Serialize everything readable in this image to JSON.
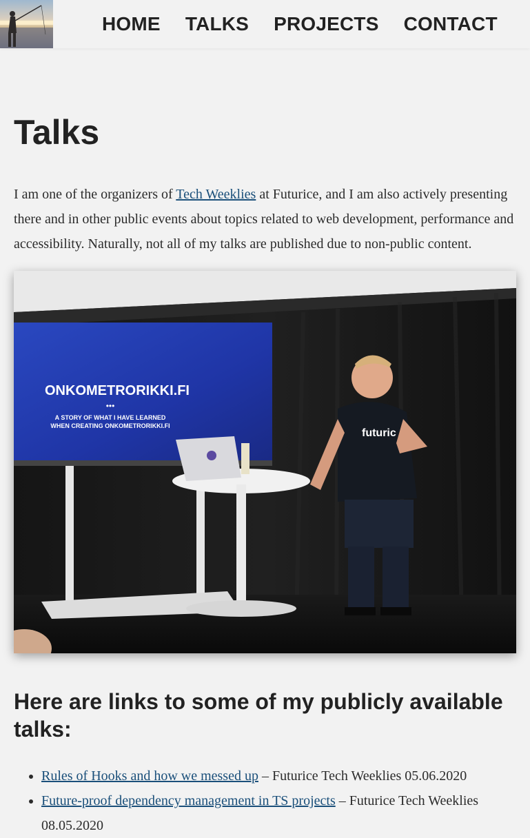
{
  "header": {
    "logo_alt": "Person fishing at sunset",
    "nav": [
      {
        "label": "HOME"
      },
      {
        "label": "TALKS"
      },
      {
        "label": "PROJECTS"
      },
      {
        "label": "CONTACT"
      }
    ]
  },
  "main": {
    "title": "Talks",
    "intro": {
      "before_link": "I am one of the organizers of ",
      "link_text": "Tech Weeklies",
      "after_link": " at Futurice, and I am also actively presenting there and in other public events about topics related to web development, performance and accessibility. Naturally, not all of my talks are published due to non-public content."
    },
    "photo": {
      "alt": "Speaker presenting in front of a screen",
      "screen_title": "ONKOMETRORIKKI.FI",
      "screen_dots": "•••",
      "screen_subtitle_line1": "A STORY OF WHAT I HAVE LEARNED",
      "screen_subtitle_line2": "WHEN CREATING ONKOMETRORIKKI.FI",
      "shirt_text": "futuric"
    },
    "links_heading": "Here are links to some of my publicly available talks:",
    "talks": [
      {
        "title": "Rules of Hooks and how we messed up",
        "meta": " – Futurice Tech Weeklies 05.06.2020"
      },
      {
        "title": "Future-proof dependency management in TS projects",
        "meta": " – Futurice Tech Weeklies 08.05.2020"
      }
    ]
  }
}
